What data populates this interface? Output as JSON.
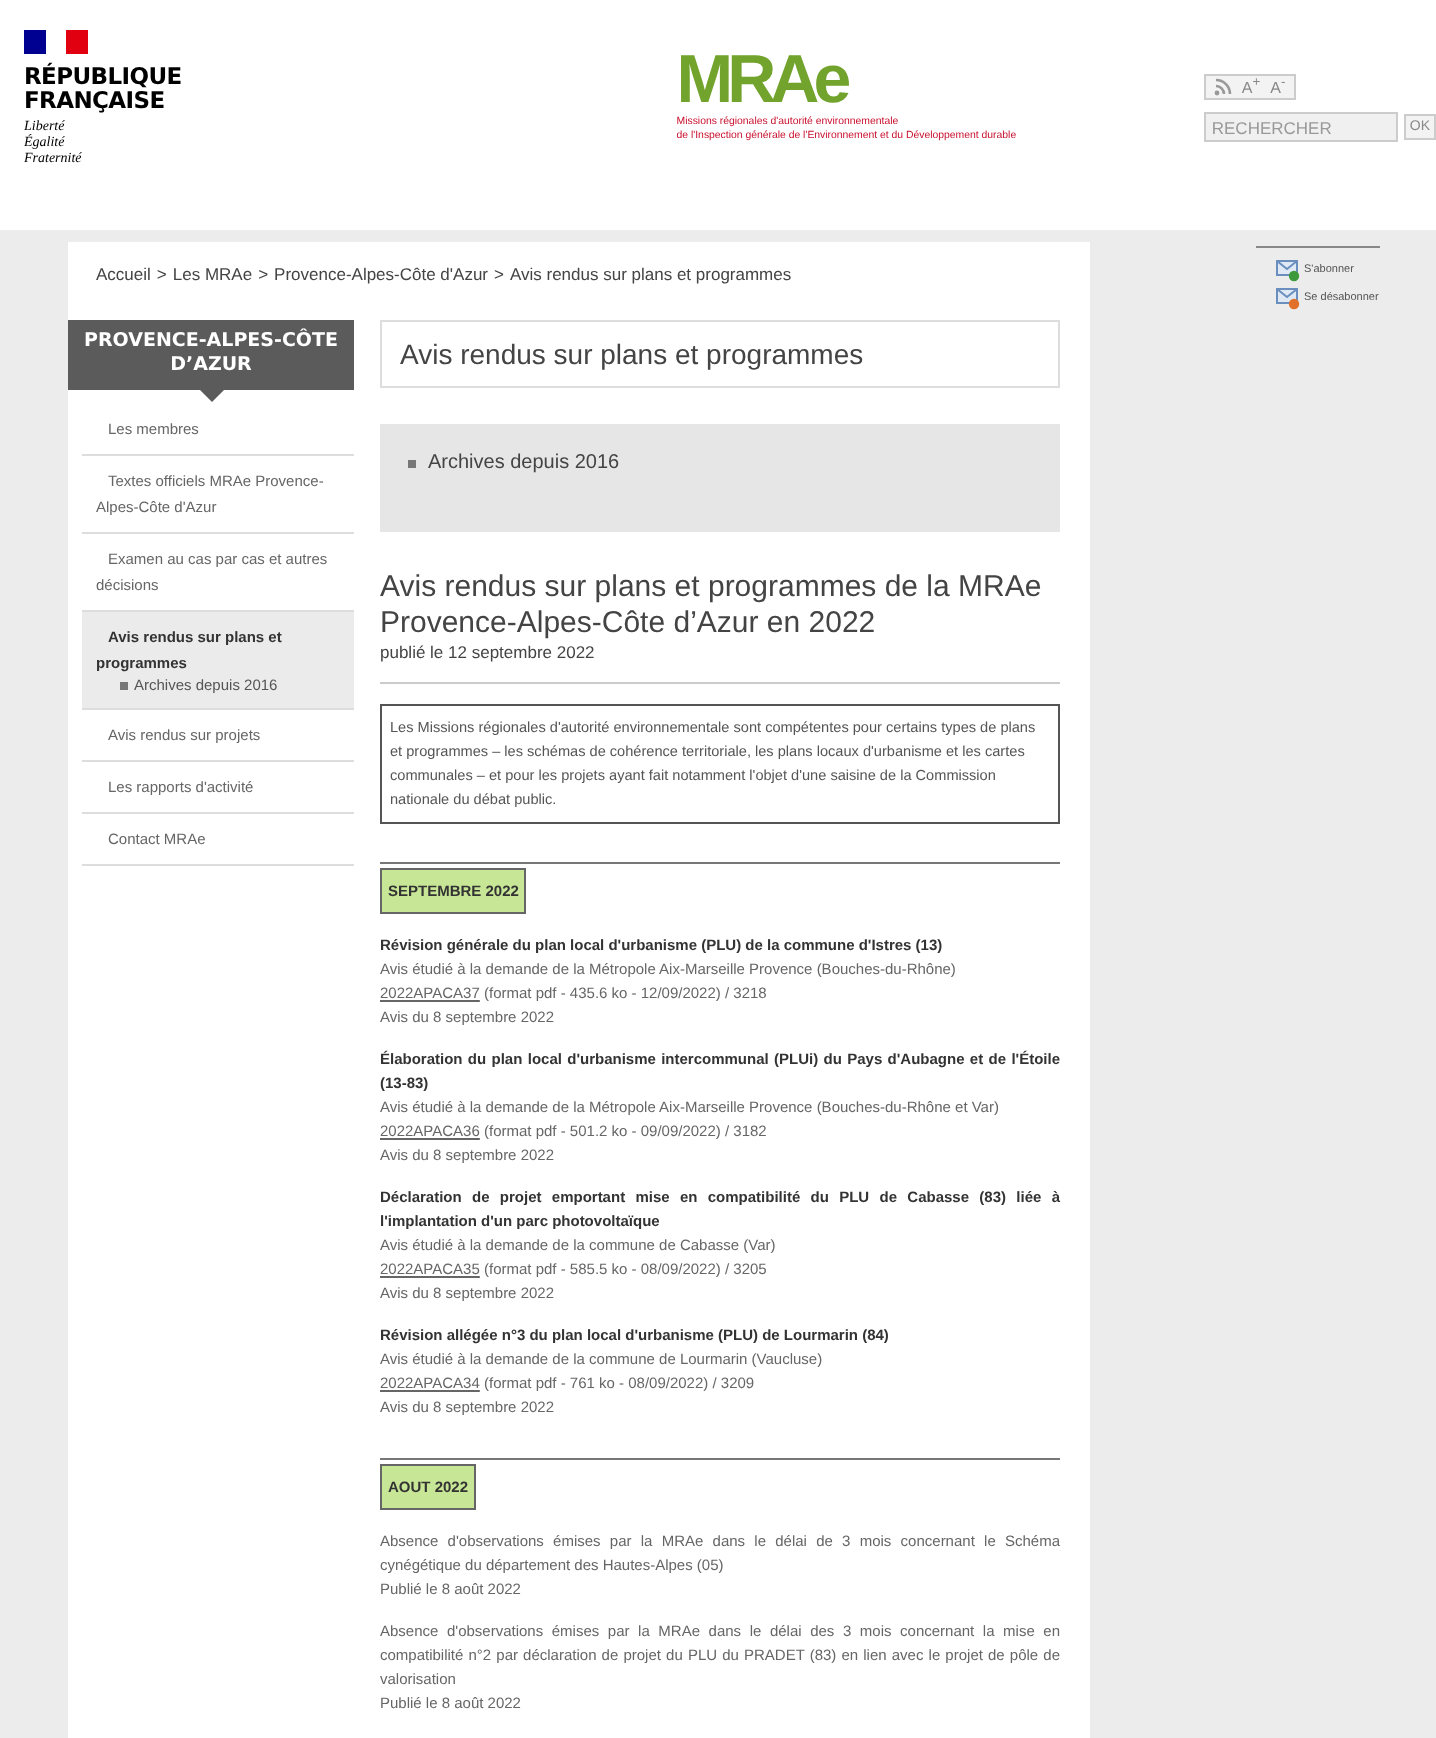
{
  "header": {
    "republic": {
      "name_lines": [
        "RÉPUBLIQUE",
        "FRANÇAISE"
      ],
      "motto": [
        "Liberté",
        "Égalité",
        "Fraternité"
      ]
    },
    "logo": {
      "text": "MRAe",
      "subtitle_lines": [
        "Missions régionales d'autorité environnementale",
        "de l'Inspection générale de l'Environnement et du Développement durable"
      ]
    },
    "tools": {
      "font_buttons": [
        "A$^{+}$",
        "A$^{-}$"
      ],
      "search": {
        "placeholder": "RECHERCHER"
      },
      "ok": "OK"
    }
  },
  "subscription_links": [
    {
      "label": "S'abonner",
      "kind": "subscribe"
    },
    {
      "label": "Se désabonner",
      "kind": "unsubscribe"
    }
  ],
  "breadcrumb": {
    "separator": ">",
    "items": [
      "Accueil",
      "Les MRAe",
      "Provence-Alpes-Côte d'Azur",
      "Avis rendus sur plans et programmes"
    ]
  },
  "sidebar": {
    "title": "PROVENCE-ALPES-CÔTE D’AZUR",
    "items": [
      {
        "label": "Les membres",
        "selected": false
      },
      {
        "label": "Textes officiels MRAe Provence-Alpes-Côte d'Azur",
        "selected": false
      },
      {
        "label": "Examen au cas par cas et autres décisions",
        "selected": false
      },
      {
        "label": "Avis rendus sur plans et programmes",
        "selected": true,
        "children": [
          {
            "label": "Archives depuis 2016"
          }
        ]
      },
      {
        "label": "Avis rendus sur projets",
        "selected": false
      },
      {
        "label": "Les rapports d'activité",
        "selected": false
      },
      {
        "label": "Contact MRAe",
        "selected": false
      }
    ]
  },
  "page_title": "Avis rendus sur plans et programmes",
  "archives": [
    "Archives depuis 2016"
  ],
  "article": {
    "title": "Avis rendus sur plans et programmes de la MRAe Provence-Alpes-Côte d’Azur en 2022",
    "date": "publié le 12 septembre 2022",
    "intro": "Les Missions régionales d'autorité environnementale sont compétentes pour certains types de plans et programmes – les schémas de cohérence territoriale, les plans locaux d'urbanisme et les cartes communales – et pour les projets ayant fait notamment l'objet d'une saisine de la Commission nationale du débat public.",
    "sections": [
      {
        "heading": "SEPTEMBRE 2022",
        "entries": [
          {
            "kind": "avis",
            "title": "Révision générale du plan local d'urbanisme (PLU) de la commune d'Istres (13)",
            "requester": "Avis étudié à la demande de la Métropole Aix-Marseille Provence (Bouches-du-Rhône)",
            "link": "2022APACA37",
            "file_info": "(format pdf - 435.6 ko - 12/09/2022) / 3218",
            "date": "Avis du 8 septembre 2022"
          },
          {
            "kind": "avis",
            "title": "Élaboration du plan local d'urbanisme intercommunal (PLUi) du Pays d'Aubagne et de l'Étoile (13-83)",
            "requester": "Avis étudié à la demande de la Métropole Aix-Marseille Provence (Bouches-du-Rhône et Var)",
            "link": "2022APACA36",
            "file_info": "(format pdf - 501.2 ko - 09/09/2022) / 3182",
            "date": "Avis du 8 septembre 2022"
          },
          {
            "kind": "avis",
            "title": "Déclaration de projet emportant mise en compatibilité du PLU de Cabasse (83) liée à l'implantation d'un parc photovoltaïque",
            "requester": "Avis étudié à la demande de la commune de Cabasse (Var)",
            "link": "2022APACA35",
            "file_info": "(format pdf - 585.5 ko - 08/09/2022) / 3205",
            "date": "Avis du 8 septembre 2022"
          },
          {
            "kind": "avis",
            "title": "Révision allégée n°3 du plan local d'urbanisme (PLU) de Lourmarin (84)",
            "requester": "Avis étudié à la demande de la commune de Lourmarin (Vaucluse)",
            "link": "2022APACA34",
            "file_info": "(format pdf - 761 ko - 08/09/2022) / 3209",
            "date": "Avis du 8 septembre 2022"
          }
        ]
      },
      {
        "heading": "AOUT 2022",
        "entries": [
          {
            "kind": "notice",
            "text": "Absence d'observations émises par la MRAe dans le délai de 3 mois concernant le Schéma cynégétique du département des Hautes-Alpes (05)",
            "date": "Publié le 8 août 2022"
          },
          {
            "kind": "notice",
            "text": "Absence d'observations émises par la MRAe dans le délai des 3 mois concernant la mise en compatibilité n°2 par déclaration de projet du PLU du PRADET (83) en lien avec le projet de pôle de valorisation",
            "date": "Publié le 8 août 2022"
          }
        ]
      }
    ]
  }
}
